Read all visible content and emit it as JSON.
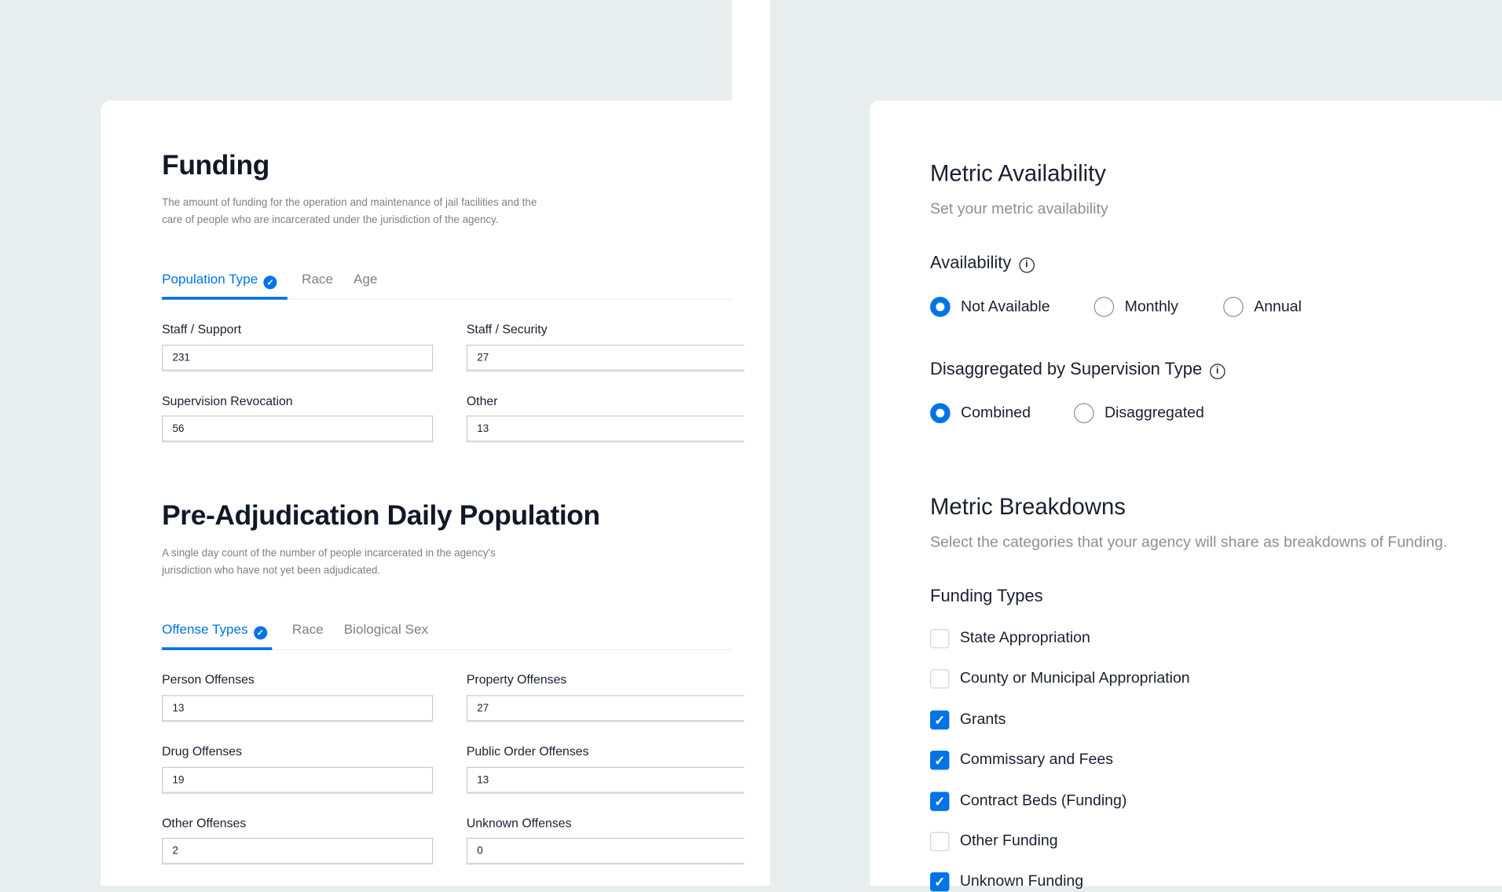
{
  "funding": {
    "title": "Funding",
    "description": "The amount of funding for the operation and maintenance of jail facilities and the care of people who are incarcerated under the jurisdiction of the agency.",
    "tabs": [
      "Population Type",
      "Race",
      "Age"
    ],
    "fields": [
      {
        "label": "Staff / Support",
        "value": "231"
      },
      {
        "label": "Staff / Security",
        "value": "27"
      },
      {
        "label": "Supervision Revocation",
        "value": "56"
      },
      {
        "label": "Other",
        "value": "13"
      }
    ]
  },
  "pre_adjudication": {
    "title": "Pre-Adjudication Daily Population",
    "description": "A single day count of the number of people incarcerated in the agency's jurisdiction who have not yet been adjudicated.",
    "tabs": [
      "Offense Types",
      "Race",
      "Biological Sex"
    ],
    "fields": [
      {
        "label": "Person Offenses",
        "value": "13"
      },
      {
        "label": "Property Offenses",
        "value": "27"
      },
      {
        "label": "Drug Offenses",
        "value": "19"
      },
      {
        "label": "Public Order Offenses",
        "value": "13"
      },
      {
        "label": "Other Offenses",
        "value": "2"
      },
      {
        "label": "Unknown Offenses",
        "value": "0"
      }
    ]
  },
  "metric_availability": {
    "title": "Metric Availability",
    "subtitle": "Set your metric availability",
    "availability": {
      "label": "Availability",
      "options": [
        "Not Available",
        "Monthly",
        "Annual"
      ],
      "selected": "Not Available"
    },
    "disaggregation": {
      "label": "Disaggregated by Supervision Type",
      "options": [
        "Combined",
        "Disaggregated"
      ],
      "selected": "Combined"
    }
  },
  "metric_breakdowns": {
    "title": "Metric Breakdowns",
    "subtitle": "Select the categories that your agency will share as breakdowns of Funding.",
    "group_label": "Funding Types",
    "items": [
      {
        "label": "State Appropriation",
        "checked": false
      },
      {
        "label": "County or Municipal Appropriation",
        "checked": false
      },
      {
        "label": "Grants",
        "checked": true
      },
      {
        "label": "Commissary and Fees",
        "checked": true
      },
      {
        "label": "Contract Beds (Funding)",
        "checked": true
      },
      {
        "label": "Other Funding",
        "checked": false
      },
      {
        "label": "Unknown Funding",
        "checked": true
      }
    ]
  },
  "colors": {
    "accent": "#0073e6",
    "background": "#e8eded"
  }
}
